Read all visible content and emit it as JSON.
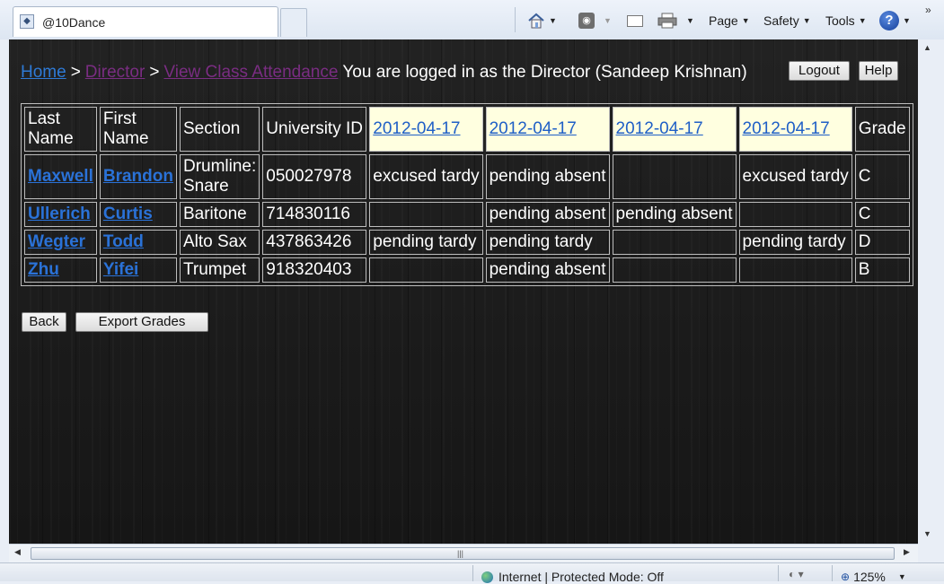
{
  "browser": {
    "tab_title": "@10Dance",
    "tab_icon": "site-favicon",
    "commands": {
      "page": "Page",
      "safety": "Safety",
      "tools": "Tools"
    },
    "help_glyph": "?",
    "more_glyph": "»"
  },
  "nav": {
    "home": "Home",
    "sep1": ">",
    "director": "Director",
    "sep2": ">",
    "view_attendance": "View Class Attendance",
    "login_text": "You are logged in as the Director (Sandeep Krishnan)",
    "logout": "Logout",
    "help": "Help"
  },
  "table": {
    "headers": {
      "last_name": "Last Name",
      "first_name": "First Name",
      "section": "Section",
      "university_id": "University ID",
      "dates": [
        "2012-04-17",
        "2012-04-17",
        "2012-04-17",
        "2012-04-17"
      ],
      "grade": "Grade"
    },
    "rows": [
      {
        "last": "Maxwell",
        "first": "Brandon",
        "section": "Drumline: Snare",
        "uid": "050027978",
        "att": [
          "excused tardy",
          "pending absent",
          "",
          "excused tardy"
        ],
        "grade": "C"
      },
      {
        "last": "Ullerich",
        "first": "Curtis",
        "section": "Baritone",
        "uid": "714830116",
        "att": [
          "",
          "pending absent",
          "pending absent",
          ""
        ],
        "grade": "C"
      },
      {
        "last": "Wegter",
        "first": "Todd",
        "section": "Alto Sax",
        "uid": "437863426",
        "att": [
          "pending tardy",
          "pending tardy",
          "",
          "pending tardy"
        ],
        "grade": "D"
      },
      {
        "last": "Zhu",
        "first": "Yifei",
        "section": "Trumpet",
        "uid": "918320403",
        "att": [
          "",
          "pending absent",
          "",
          ""
        ],
        "grade": "B"
      }
    ]
  },
  "actions": {
    "back": "Back",
    "export": "Export Grades"
  },
  "status": {
    "zone": "Internet | Protected Mode: Off",
    "zoom": "125%"
  },
  "colors": {
    "link": "#2e7ad6",
    "visited_link": "#7a2d82",
    "date_header_bg": "#ffffe0",
    "page_bg": "#1c1c1c"
  }
}
